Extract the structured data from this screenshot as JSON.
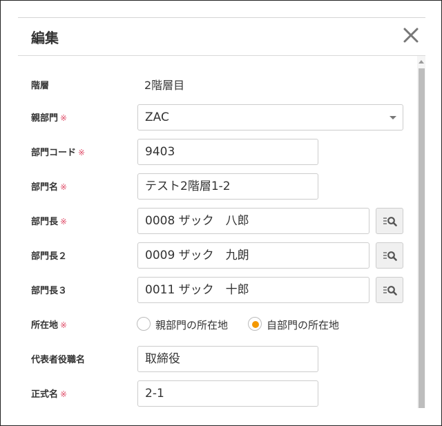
{
  "dialog": {
    "title": "編集",
    "close_icon": "close-icon"
  },
  "colors": {
    "required_mark": "#e0506b",
    "radio_selected": "#f39800",
    "border": "#cccccc"
  },
  "required_mark": "※",
  "fields": {
    "hierarchy": {
      "label": "階層",
      "value": "2階層目"
    },
    "parent_department": {
      "label": "親部門",
      "value": "ZAC",
      "required": true
    },
    "department_code": {
      "label": "部門コード",
      "value": "9403",
      "required": true
    },
    "department_name": {
      "label": "部門名",
      "value": "テスト2階層1-2",
      "required": true
    },
    "department_head": {
      "label": "部門長",
      "value": "0008 ザック　八郎",
      "required": true,
      "lookup_icon": "list-search-icon"
    },
    "department_head_2": {
      "label": "部門長２",
      "value": "0009 ザック　九朗",
      "lookup_icon": "list-search-icon"
    },
    "department_head_3": {
      "label": "部門長３",
      "value": "0011 ザック　十郎",
      "lookup_icon": "list-search-icon"
    },
    "location": {
      "label": "所在地",
      "required": true,
      "options": [
        {
          "label": "親部門の所在地",
          "selected": false
        },
        {
          "label": "自部門の所在地",
          "selected": true
        }
      ]
    },
    "representative_title": {
      "label": "代表者役職名",
      "value": "取締役"
    },
    "official_name": {
      "label": "正式名",
      "value": "2-1",
      "required": true
    }
  }
}
